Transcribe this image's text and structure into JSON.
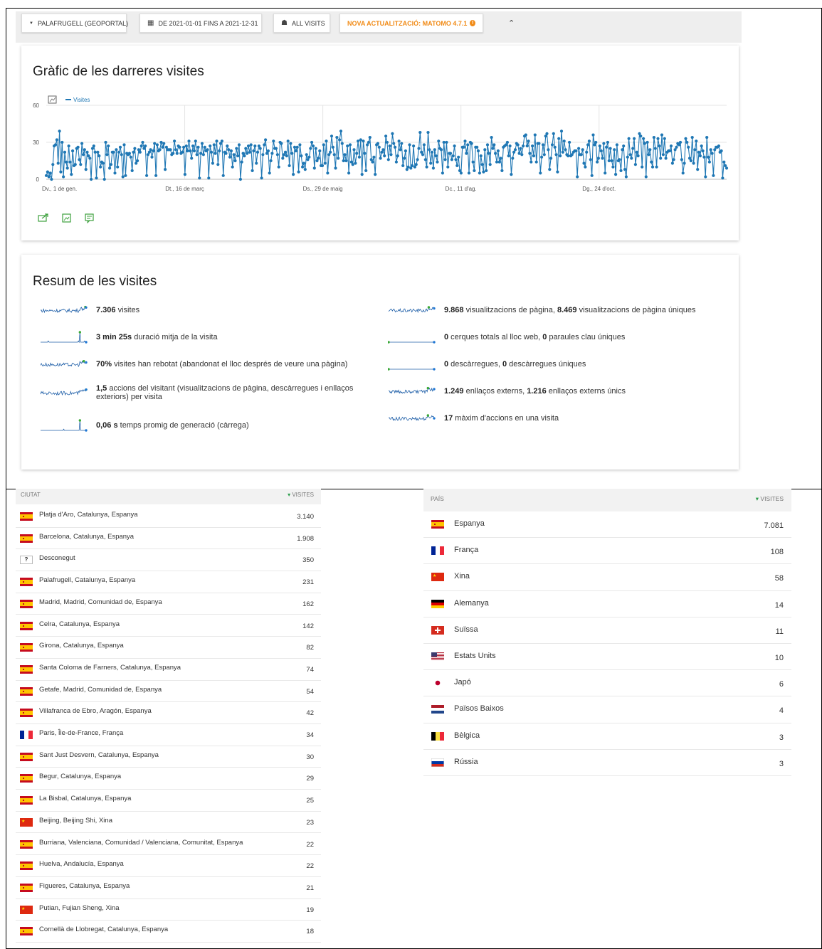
{
  "toolbar": {
    "site": "PALAFRUGELL (GEOPORTAL)",
    "period": "DE 2021-01-01 FINS A 2021-12-31",
    "segment": "ALL VISITS",
    "update": "NOVA ACTUALITZACIÓ: MATOMO 4.7.1"
  },
  "chart_card": {
    "title": "Gràfic de les darreres visites"
  },
  "chart_data": {
    "type": "line",
    "series": [
      {
        "name": "Visites",
        "color": "#1f77b4",
        "values": [
          3,
          6,
          2,
          5,
          0,
          12,
          27,
          28,
          32,
          13,
          39,
          6,
          30,
          2,
          22,
          14,
          9,
          27,
          14,
          4,
          23,
          11,
          12,
          25,
          26,
          16,
          12,
          29,
          20,
          24,
          8,
          22,
          19,
          17,
          0,
          25,
          27,
          22,
          1,
          22,
          19,
          10,
          14,
          13,
          0,
          30,
          20,
          27,
          9,
          12,
          22,
          22,
          5,
          24,
          10,
          22,
          26,
          20,
          2,
          28,
          3,
          21,
          20,
          21,
          18,
          7,
          22,
          25,
          13,
          15,
          24,
          22,
          27,
          30,
          25,
          27,
          3,
          20,
          22,
          24,
          18,
          23,
          29,
          3,
          28,
          23,
          24,
          30,
          26,
          29,
          8,
          26,
          24,
          24,
          24,
          20,
          21,
          31,
          24,
          21,
          27,
          26,
          21,
          22,
          26,
          4,
          27,
          23,
          31,
          23,
          17,
          27,
          23,
          31,
          20,
          26,
          1,
          21,
          29,
          20,
          26,
          23,
          24,
          1,
          27,
          22,
          13,
          28,
          21,
          31,
          12,
          23,
          29,
          31,
          3,
          22,
          21,
          27,
          24,
          18,
          23,
          10,
          20,
          15,
          25,
          19,
          28,
          0,
          14,
          21,
          19,
          25,
          21,
          27,
          22,
          28,
          7,
          23,
          27,
          13,
          22,
          27,
          25,
          1,
          20,
          28,
          32,
          21,
          23,
          5,
          15,
          21,
          31,
          25,
          25,
          20,
          10,
          30,
          29,
          17,
          20,
          22,
          19,
          31,
          11,
          29,
          21,
          4,
          26,
          23,
          26,
          6,
          28,
          19,
          10,
          13,
          8,
          20,
          16,
          18,
          25,
          30,
          27,
          9,
          25,
          15,
          17,
          23,
          11,
          11,
          28,
          13,
          31,
          5,
          20,
          22,
          35,
          26,
          20,
          9,
          34,
          17,
          32,
          39,
          29,
          15,
          20,
          15,
          27,
          5,
          28,
          14,
          12,
          24,
          13,
          21,
          31,
          18,
          32,
          4,
          31,
          21,
          7,
          28,
          30,
          34,
          16,
          14,
          18,
          4,
          28,
          29,
          26,
          17,
          22,
          24,
          19,
          35,
          30,
          16,
          27,
          20,
          37,
          29,
          26,
          14,
          19,
          31,
          24,
          29,
          11,
          17,
          23,
          8,
          10,
          28,
          9,
          11,
          27,
          10,
          12,
          16,
          25,
          38,
          22,
          20,
          28,
          16,
          10,
          38,
          24,
          13,
          22,
          9,
          24,
          19,
          14,
          31,
          25,
          24,
          5,
          30,
          16,
          30,
          10,
          21,
          21,
          16,
          19,
          27,
          16,
          11,
          18,
          7,
          5,
          26,
          26,
          31,
          21,
          28,
          5,
          30,
          29,
          14,
          7,
          26,
          26,
          23,
          5,
          19,
          12,
          6,
          24,
          7,
          28,
          21,
          12,
          34,
          25,
          28,
          21,
          14,
          23,
          14,
          17,
          7,
          26,
          27,
          28,
          30,
          19,
          27,
          4,
          17,
          22,
          24,
          29,
          28,
          21,
          25,
          20,
          27,
          35,
          36,
          27,
          31,
          21,
          14,
          27,
          19,
          36,
          14,
          29,
          29,
          5,
          18,
          28,
          20,
          35,
          37,
          24,
          8,
          17,
          28,
          37,
          26,
          20,
          6,
          33,
          19,
          39,
          22,
          31,
          24,
          20,
          19,
          30,
          19,
          20,
          22,
          23,
          23,
          2,
          25,
          20,
          20,
          24,
          13,
          10,
          22,
          28,
          31,
          16,
          3,
          36,
          28,
          30,
          14,
          17,
          27,
          23,
          17,
          29,
          5,
          26,
          30,
          15,
          25,
          15,
          10,
          24,
          4,
          28,
          15,
          16,
          7,
          24,
          27,
          8,
          2,
          18,
          33,
          20,
          17,
          25,
          33,
          12,
          22,
          19,
          37,
          35,
          10,
          33,
          29,
          2,
          30,
          20,
          24,
          14,
          10,
          34,
          25,
          10,
          33,
          27,
          17,
          36,
          20,
          33,
          17,
          22,
          23,
          23,
          27,
          13,
          16,
          24,
          26,
          29,
          28,
          30,
          16,
          5,
          13,
          33,
          30,
          26,
          17,
          15,
          34,
          13,
          24,
          31,
          8,
          22,
          19,
          27,
          23,
          18,
          2,
          34,
          18,
          14,
          24,
          21,
          3,
          24,
          26,
          26,
          27,
          22,
          23,
          1,
          14,
          11,
          9
        ]
      }
    ],
    "x_ticks": [
      "Dv., 1 de gen.",
      "Dt., 16 de març",
      "Ds., 29 de maig",
      "Dc., 11 d'ag.",
      "Dg., 24 d'oct."
    ],
    "y_ticks": [
      0,
      30,
      60
    ],
    "ylim": [
      0,
      60
    ],
    "grid": true,
    "legend": "top-left"
  },
  "summary": {
    "title": "Resum de les visites",
    "left": [
      {
        "bold": "7.306",
        "text": " visites"
      },
      {
        "bold": "3 min 25s",
        "text": " duració mitja de la visita"
      },
      {
        "bold": "70%",
        "text": " visites han rebotat (abandonat el lloc després de veure una pàgina)"
      },
      {
        "bold": "1,5",
        "text": " accions del visitant (visualitzacions de pàgina, descàrregues i enllaços exteriors) per visita"
      },
      {
        "bold": "0,06 s",
        "text": " temps promig de generació (càrrega)"
      }
    ],
    "right": [
      {
        "b1": "9.868",
        "t1": " visualitzacions de pàgina, ",
        "b2": "8.469",
        "t2": " visualitzacions de pàgina úniques"
      },
      {
        "b1": "0",
        "t1": " cerques totals al lloc web, ",
        "b2": "0",
        "t2": " paraules clau úniques"
      },
      {
        "b1": "0",
        "t1": " descàrregues, ",
        "b2": "0",
        "t2": " descàrregues úniques"
      },
      {
        "b1": "1.249",
        "t1": " enllaços externs, ",
        "b2": "1.216",
        "t2": " enllaços externs únics"
      },
      {
        "b1": "17",
        "t1": " màxim d'accions en una visita",
        "b2": "",
        "t2": ""
      }
    ]
  },
  "city_table": {
    "col_name": "CIUTAT",
    "col_value": "VISITES",
    "rows": [
      {
        "flag": "es",
        "name": "Platja d'Aro, Catalunya, Espanya",
        "value": "3.140"
      },
      {
        "flag": "es",
        "name": "Barcelona, Catalunya, Espanya",
        "value": "1.908"
      },
      {
        "flag": "unknown",
        "name": "Desconegut",
        "value": "350"
      },
      {
        "flag": "es",
        "name": "Palafrugell, Catalunya, Espanya",
        "value": "231"
      },
      {
        "flag": "es",
        "name": "Madrid, Madrid, Comunidad de, Espanya",
        "value": "162"
      },
      {
        "flag": "es",
        "name": "Celra, Catalunya, Espanya",
        "value": "142"
      },
      {
        "flag": "es",
        "name": "Girona, Catalunya, Espanya",
        "value": "82"
      },
      {
        "flag": "es",
        "name": "Santa Coloma de Farners, Catalunya, Espanya",
        "value": "74"
      },
      {
        "flag": "es",
        "name": "Getafe, Madrid, Comunidad de, Espanya",
        "value": "54"
      },
      {
        "flag": "es",
        "name": "Villafranca de Ebro, Aragón, Espanya",
        "value": "42"
      },
      {
        "flag": "fr",
        "name": "Paris, Île-de-France, França",
        "value": "34"
      },
      {
        "flag": "es",
        "name": "Sant Just Desvern, Catalunya, Espanya",
        "value": "30"
      },
      {
        "flag": "es",
        "name": "Begur, Catalunya, Espanya",
        "value": "29"
      },
      {
        "flag": "es",
        "name": "La Bisbal, Catalunya, Espanya",
        "value": "25"
      },
      {
        "flag": "cn",
        "name": "Beijing, Beijing Shi, Xina",
        "value": "23"
      },
      {
        "flag": "es",
        "name": "Burriana, Valenciana, Comunidad / Valenciana, Comunitat, Espanya",
        "value": "22"
      },
      {
        "flag": "es",
        "name": "Huelva, Andalucía, Espanya",
        "value": "22"
      },
      {
        "flag": "es",
        "name": "Figueres, Catalunya, Espanya",
        "value": "21"
      },
      {
        "flag": "cn",
        "name": "Putian, Fujian Sheng, Xina",
        "value": "19"
      },
      {
        "flag": "es",
        "name": "Cornellà de Llobregat, Catalunya, Espanya",
        "value": "18"
      }
    ]
  },
  "country_table": {
    "col_name": "PAÍS",
    "col_value": "VISITES",
    "rows": [
      {
        "flag": "es",
        "name": "Espanya",
        "value": "7.081"
      },
      {
        "flag": "fr",
        "name": "França",
        "value": "108"
      },
      {
        "flag": "cn",
        "name": "Xina",
        "value": "58"
      },
      {
        "flag": "de",
        "name": "Alemanya",
        "value": "14"
      },
      {
        "flag": "ch",
        "name": "Suïssa",
        "value": "11"
      },
      {
        "flag": "us",
        "name": "Estats Units",
        "value": "10"
      },
      {
        "flag": "jp",
        "name": "Japó",
        "value": "6"
      },
      {
        "flag": "nl",
        "name": "Països Baixos",
        "value": "4"
      },
      {
        "flag": "be",
        "name": "Bèlgica",
        "value": "3"
      },
      {
        "flag": "ru",
        "name": "Rússia",
        "value": "3"
      }
    ]
  }
}
